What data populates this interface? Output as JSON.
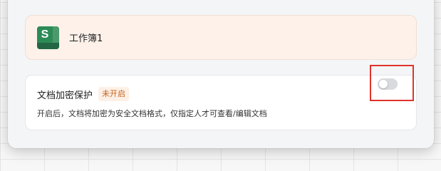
{
  "file": {
    "name": "工作簿1",
    "icon": "spreadsheet-file-icon",
    "icon_letter": "S",
    "icon_color": "#2f7a52"
  },
  "protection": {
    "title": "文档加密保护",
    "status": "未开启",
    "description": "开启后，文档将加密为安全文档格式，仅指定人才可查看/编辑文档",
    "enabled": false
  },
  "colors": {
    "accent_status": "#c26520",
    "highlight": "#e0342b"
  }
}
